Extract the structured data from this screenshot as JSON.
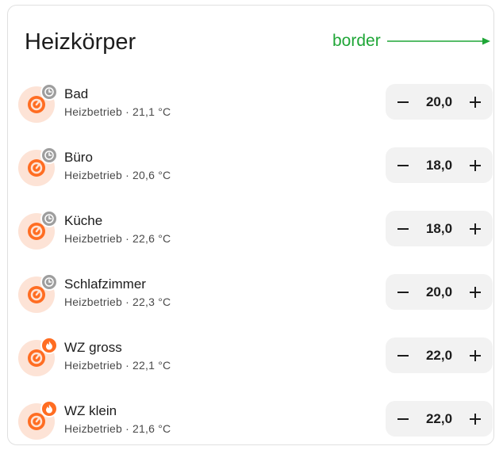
{
  "card": {
    "title": "Heizkörper"
  },
  "annotation": {
    "label": "border",
    "color": "#1fa637"
  },
  "colors": {
    "accent": "#ff6d22",
    "icon_bg": "#fde3d6",
    "idle_badge": "#9e9e9e"
  },
  "rows": [
    {
      "name": "Bad",
      "status": "Heizbetrieb · 21,1 °C",
      "target": "20,0",
      "badge": "clock-icon",
      "decrease_symbol": "−",
      "increase_symbol": "+"
    },
    {
      "name": "Büro",
      "status": "Heizbetrieb · 20,6 °C",
      "target": "18,0",
      "badge": "clock-icon",
      "decrease_symbol": "−",
      "increase_symbol": "+"
    },
    {
      "name": "Küche",
      "status": "Heizbetrieb · 22,6 °C",
      "target": "18,0",
      "badge": "clock-icon",
      "decrease_symbol": "−",
      "increase_symbol": "+"
    },
    {
      "name": "Schlafzimmer",
      "status": "Heizbetrieb · 22,3 °C",
      "target": "20,0",
      "badge": "clock-icon",
      "decrease_symbol": "−",
      "increase_symbol": "+"
    },
    {
      "name": "WZ gross",
      "status": "Heizbetrieb · 22,1 °C",
      "target": "22,0",
      "badge": "flame-icon",
      "decrease_symbol": "−",
      "increase_symbol": "+"
    },
    {
      "name": "WZ klein",
      "status": "Heizbetrieb · 21,6 °C",
      "target": "22,0",
      "badge": "flame-icon",
      "decrease_symbol": "−",
      "increase_symbol": "+"
    }
  ]
}
